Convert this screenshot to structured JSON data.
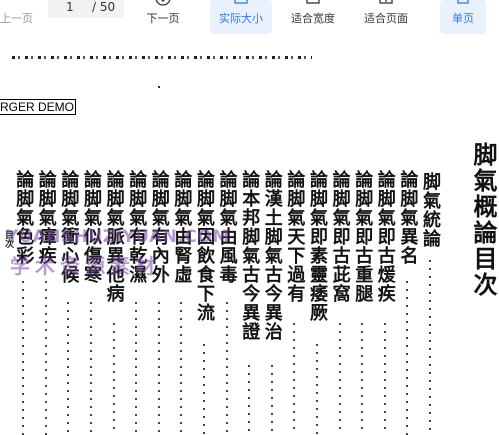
{
  "toolbar": {
    "prev_label": "上一页",
    "current_page": "1",
    "total_pages": "/ 50",
    "next_label": "下一页",
    "actual_size_label": "实际大小",
    "fit_width_label": "适合宽度",
    "fit_page_label": "适合页面",
    "single_page_label": "单页",
    "accent_color": "#2f7de1"
  },
  "document": {
    "demo_banner": "RGER DEMO",
    "title": "脚氣概論目次",
    "entries": [
      "脚氣統論",
      "論脚氣異名",
      "論脚氣即古煖疾",
      "論脚氣即古重腿",
      "論脚氣即古茈窩",
      "論脚氣即素靈痿厥",
      "論脚氣天下過有",
      "論漢土脚氣古今異治",
      "論本邦脚氣古今異證",
      "論脚氣由風毒",
      "論脚氣因飲食下流",
      "論脚氣由腎虛",
      "論脚氣有內外",
      "論脚氣有乾濕",
      "論脚氣脈異他病",
      "論脚氣似傷寒",
      "論脚氣衝心候",
      "論脚氣瘴疾",
      "論脚氣色彩"
    ],
    "side_note": "目次",
    "watermark_line1": "YUANSHUZIYUAN.COM",
    "watermark_line2": "学术资源素材"
  }
}
